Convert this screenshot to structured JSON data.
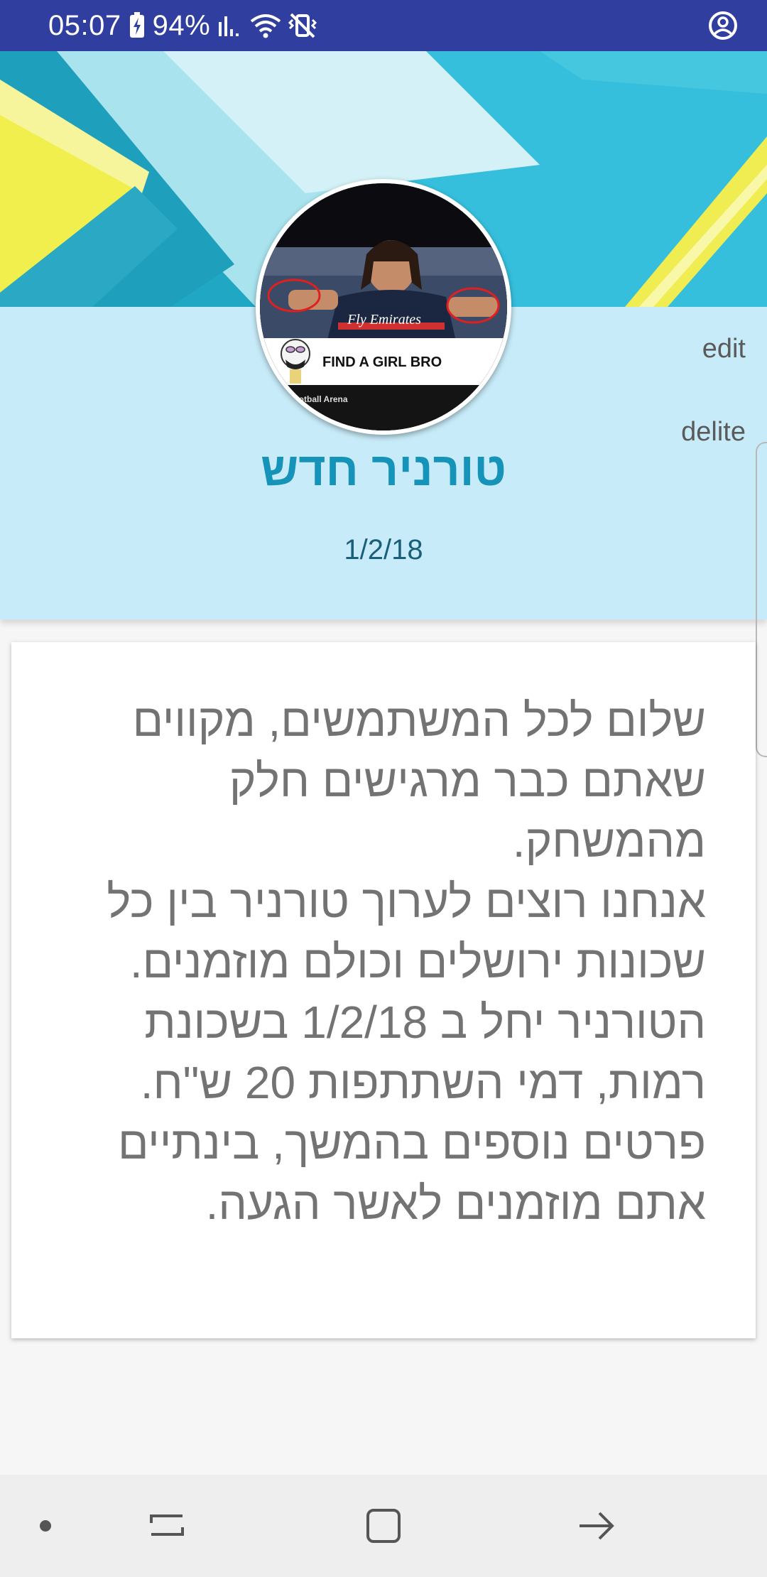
{
  "status_bar": {
    "time": "05:07",
    "battery": "94%",
    "icons": [
      "battery-charging-icon",
      "signal-icon",
      "wifi-icon",
      "vibrate-icon",
      "account-icon"
    ]
  },
  "event": {
    "title": "טורניר חדש",
    "date": "1/2/18",
    "edit_label": "edit",
    "delete_label": "delite",
    "image_caption": "FIND A GIRL BRO",
    "image_sponsor": "Fly Emirates",
    "image_footer": "Football Arena"
  },
  "message": {
    "paragraphs": [
      "שלום לכל המשתמשים, מקווים שאתם כבר מרגישים חלק מהמשחק.",
      "אנחנו רוצים לערוך טורניר בין כל שכונות ירושלים וכולם מוזמנים. הטורניר יחל ב 1/2/18 בשכונת רמות, דמי השתתפות 20 ש\"ח.",
      "פרטים נוספים בהמשך, בינתיים אתם מוזמנים לאשר הגעה."
    ]
  },
  "nav_bar": {
    "icons": [
      "dot-icon",
      "recents-icon",
      "home-icon",
      "back-icon"
    ]
  },
  "colors": {
    "status_bar": "#303f9f",
    "panel": "#c7ebf8",
    "title": "#1593b8",
    "message_text": "#737373"
  }
}
